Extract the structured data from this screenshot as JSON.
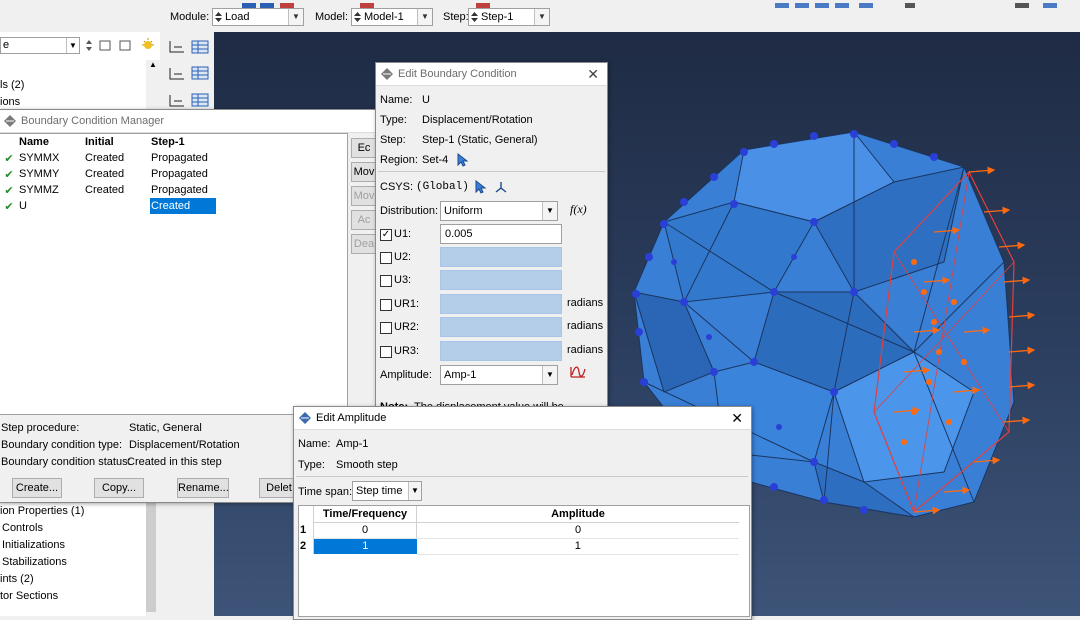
{
  "context_bar": {
    "module_label": "Module:",
    "module_value": "Load",
    "model_label": "Model:",
    "model_value": "Model-1",
    "step_label": "Step:",
    "step_value": "Step-1"
  },
  "model_tree": {
    "items_top": [
      "ls (2)",
      "ions"
    ],
    "items_bottom": [
      "ion Properties (1)",
      "Controls",
      "Initializations",
      "Stabilizations",
      "ints (2)",
      "tor Sections"
    ]
  },
  "bc_manager": {
    "title": "Boundary Condition Manager",
    "columns": [
      "Name",
      "Initial",
      "Step-1"
    ],
    "rows": [
      {
        "name": "SYMMX",
        "initial": "Created",
        "step1": "Propagated"
      },
      {
        "name": "SYMMY",
        "initial": "Created",
        "step1": "Propagated"
      },
      {
        "name": "SYMMZ",
        "initial": "Created",
        "step1": "Propagated"
      },
      {
        "name": "U",
        "initial": "",
        "step1": "Created"
      }
    ],
    "side_buttons": [
      "Ec",
      "Mov",
      "Mov",
      "Ac",
      "Dea"
    ],
    "info": [
      {
        "label": "Step procedure:",
        "value": "Static, General"
      },
      {
        "label": "Boundary condition type:",
        "value": "Displacement/Rotation"
      },
      {
        "label": "Boundary condition status:",
        "value": "Created in this step"
      }
    ],
    "buttons": {
      "create": "Create...",
      "copy": "Copy...",
      "rename": "Rename...",
      "delete": "Delet"
    }
  },
  "edit_bc": {
    "title": "Edit Boundary Condition",
    "name_label": "Name:",
    "name_value": "U",
    "type_label": "Type:",
    "type_value": "Displacement/Rotation",
    "step_label": "Step:",
    "step_value": "Step-1 (Static, General)",
    "region_label": "Region:",
    "region_value": "Set-4",
    "csys_label": "CSYS:",
    "csys_value": "(Global)",
    "distribution_label": "Distribution:",
    "distribution_value": "Uniform",
    "fx_label": "f(x)",
    "dofs": [
      {
        "label": "U1:",
        "value": "0.005",
        "checked": true,
        "unit": ""
      },
      {
        "label": "U2:",
        "value": "",
        "checked": false,
        "unit": ""
      },
      {
        "label": "U3:",
        "value": "",
        "checked": false,
        "unit": ""
      },
      {
        "label": "UR1:",
        "value": "",
        "checked": false,
        "unit": "radians"
      },
      {
        "label": "UR2:",
        "value": "",
        "checked": false,
        "unit": "radians"
      },
      {
        "label": "UR3:",
        "value": "",
        "checked": false,
        "unit": "radians"
      }
    ],
    "amplitude_label": "Amplitude:",
    "amplitude_value": "Amp-1",
    "note_label": "Note:",
    "note_text": "The displacement value will be"
  },
  "edit_amp": {
    "title": "Edit Amplitude",
    "name_label": "Name:",
    "name_value": "Amp-1",
    "type_label": "Type:",
    "type_value": "Smooth step",
    "timespan_label": "Time span:",
    "timespan_value": "Step time",
    "columns": [
      "Time/Frequency",
      "Amplitude"
    ],
    "rows": [
      {
        "index": "1",
        "time": "0",
        "amp": "0"
      },
      {
        "index": "2",
        "time": "1",
        "amp": "1"
      }
    ]
  },
  "colors": {
    "selection": "#0078d7",
    "mesh_face": "#3a7fd6",
    "bc_symbol": "#2a3fd8",
    "load_arrow": "#ff6a10",
    "check": "#2a8a2a"
  }
}
